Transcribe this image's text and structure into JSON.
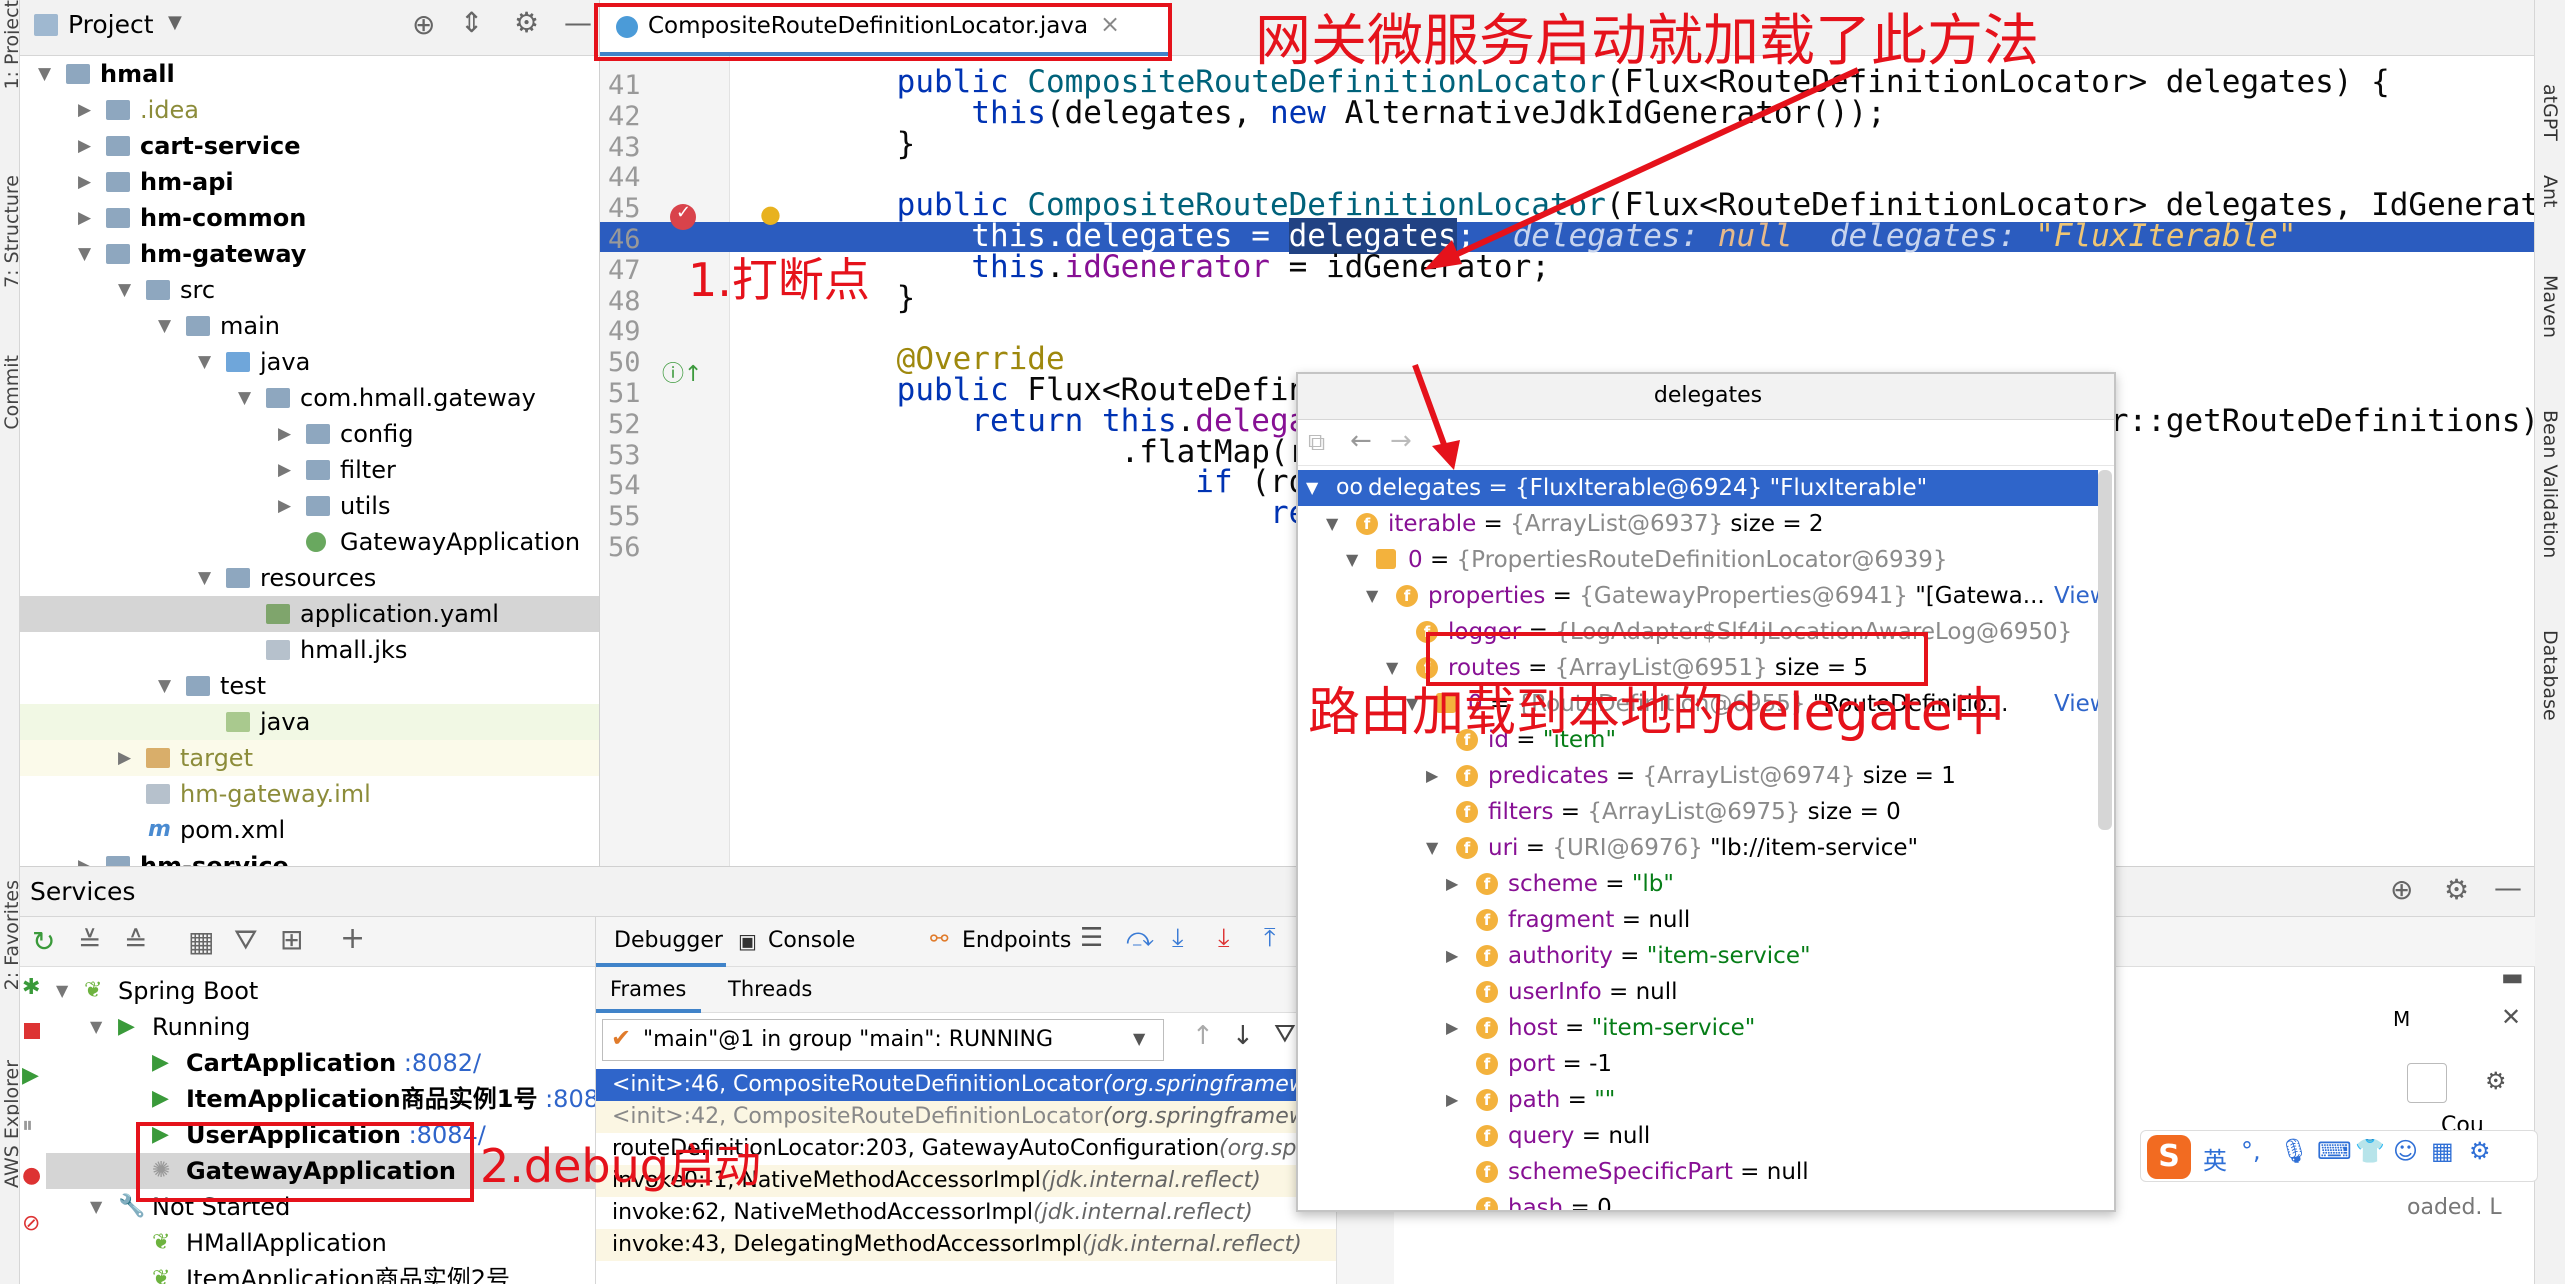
{
  "left_strip": {
    "tabs": [
      "1: Project",
      "7: Structure",
      "Commit",
      "2: Favorites",
      "AWS Explorer"
    ]
  },
  "right_strip": {
    "tabs": [
      "atGPT",
      "Ant",
      "Maven",
      "Bean Validation",
      "Database"
    ]
  },
  "project": {
    "title": "Project",
    "tree": [
      {
        "label": "hmall",
        "depth": 0,
        "arrow": "▼",
        "icon": "fold",
        "bold": true
      },
      {
        "label": ".idea",
        "depth": 1,
        "arrow": "▶",
        "icon": "fold",
        "color": "#8c8c3a"
      },
      {
        "label": "cart-service",
        "depth": 1,
        "arrow": "▶",
        "icon": "fold",
        "bold": true
      },
      {
        "label": "hm-api",
        "depth": 1,
        "arrow": "▶",
        "icon": "fold",
        "bold": true
      },
      {
        "label": "hm-common",
        "depth": 1,
        "arrow": "▶",
        "icon": "fold",
        "bold": true
      },
      {
        "label": "hm-gateway",
        "depth": 1,
        "arrow": "▼",
        "icon": "fold",
        "bold": true
      },
      {
        "label": "src",
        "depth": 2,
        "arrow": "▼",
        "icon": "fold"
      },
      {
        "label": "main",
        "depth": 3,
        "arrow": "▼",
        "icon": "fold"
      },
      {
        "label": "java",
        "depth": 4,
        "arrow": "▼",
        "icon": "foldb"
      },
      {
        "label": "com.hmall.gateway",
        "depth": 5,
        "arrow": "▼",
        "icon": "fold"
      },
      {
        "label": "config",
        "depth": 6,
        "arrow": "▶",
        "icon": "fold"
      },
      {
        "label": "filter",
        "depth": 6,
        "arrow": "▶",
        "icon": "fold"
      },
      {
        "label": "utils",
        "depth": 6,
        "arrow": "▶",
        "icon": "fold"
      },
      {
        "label": "GatewayApplication",
        "depth": 6,
        "arrow": "",
        "icon": "fileg"
      },
      {
        "label": "resources",
        "depth": 4,
        "arrow": "▼",
        "icon": "fold"
      },
      {
        "label": "application.yaml",
        "depth": 5,
        "arrow": "",
        "icon": "filey",
        "selected": true
      },
      {
        "label": "hmall.jks",
        "depth": 5,
        "arrow": "",
        "icon": "filej"
      },
      {
        "label": "test",
        "depth": 3,
        "arrow": "▼",
        "icon": "fold"
      },
      {
        "label": "java",
        "depth": 4,
        "arrow": "",
        "icon": "foldg",
        "highlight": true
      },
      {
        "label": "target",
        "depth": 2,
        "arrow": "▶",
        "icon": "foldo",
        "color": "#8c8c3a",
        "highlight2": true
      },
      {
        "label": "hm-gateway.iml",
        "depth": 2,
        "arrow": "",
        "icon": "filej",
        "color": "#8c8c3a"
      },
      {
        "label": "pom.xml",
        "depth": 2,
        "arrow": "",
        "icon": "m"
      },
      {
        "label": "hm-service",
        "depth": 1,
        "arrow": "▶",
        "icon": "fold",
        "bold": true
      }
    ]
  },
  "editor": {
    "tab": "CompositeRouteDefinitionLocator.java",
    "close": "×",
    "lines": [
      {
        "n": "41",
        "html": "    <span class=\"kw\">public</span> <span class=\"ty\">CompositeRouteDefinitionLocator</span>(Flux&lt;RouteDefinitionLocator&gt; delegates) {"
      },
      {
        "n": "42",
        "html": "        <span class=\"kw\">this</span>(delegates, <span class=\"kw\">new</span> AlternativeJdkIdGenerator());"
      },
      {
        "n": "43",
        "html": "    }"
      },
      {
        "n": "44",
        "html": ""
      },
      {
        "n": "45",
        "html": "    <span class=\"kw\">public</span> <span class=\"ty\">CompositeRouteDefinitionLocator</span>(Flux&lt;RouteDefinitionLocator&gt; delegates, IdGenerator idGenerator) {"
      },
      {
        "n": "46",
        "html": "        this.delegates = <span class=\"hl\">delegates</span>;  <i style=\"color:#c7d4ee\">delegates: </i><i style=\"color:#e6b98a\">null</i>  <i style=\"color:#c7d4ee\">delegates: </i><i style=\"color:#f0c674\">\"FluxIterable\"</i>"
      },
      {
        "n": "47",
        "html": "        <span class=\"kw\">this</span>.<span class=\"fi\">idGenerator</span> = idGenerator;"
      },
      {
        "n": "48",
        "html": "    }"
      },
      {
        "n": "49",
        "html": ""
      },
      {
        "n": "50",
        "html": "    <span class=\"an\">@Override</span>"
      },
      {
        "n": "51",
        "html": "    <span class=\"kw\">public</span> Flux&lt;RouteDefinition&gt; getRouteDefinitions() {"
      },
      {
        "n": "52",
        "html": "        <span class=\"kw\">return</span> <span class=\"kw\">this</span>.<span class=\"fi\">delegates</span>.flatMapSequential(RouteDefinitionLocator::getRouteDefinitions)"
      },
      {
        "n": "53",
        "html": "                .flatMap(routeDefinition -&gt; {"
      },
      {
        "n": "54",
        "html": "                    <span class=\"kw\">if</span> (routeDefinition.getId() == <span class=\"kw\">null</span>) {"
      },
      {
        "n": "55",
        "html": "                        <span class=\"kw\">return</span> randomId().map(id -&gt; {"
      },
      {
        "n": "56",
        "html": ""
      }
    ]
  },
  "popup": {
    "title": "delegates",
    "rows": [
      {
        "d": 0,
        "tri": "▼",
        "ico": "oo",
        "name": "delegates",
        "val": " = {FluxIterable@6924} \"FluxIterable\"",
        "sel": true
      },
      {
        "d": 1,
        "tri": "▼",
        "ico": "f",
        "name": "iterable",
        "eq": " = ",
        "gray": "{ArrayList@6937}",
        "rest": "  size = 2"
      },
      {
        "d": 2,
        "tri": "▼",
        "ico": "=",
        "name": "0",
        "eq": " = ",
        "gray": "{PropertiesRouteDefinitionLocator@6939}",
        "rest": ""
      },
      {
        "d": 3,
        "tri": "▼",
        "ico": "f",
        "name": "properties",
        "eq": " = ",
        "gray": "{GatewayProperties@6941}",
        "rest": " \"[Gatewa...",
        "link": "View"
      },
      {
        "d": 4,
        "tri": "",
        "ico": "f",
        "name": "logger",
        "eq": " = ",
        "gray": "{LogAdapter$Slf4jLocationAwareLog@6950}",
        "rest": ""
      },
      {
        "d": 4,
        "tri": "▼",
        "ico": "f",
        "name": "routes",
        "eq": " = ",
        "gray": "{ArrayList@6951}",
        "rest": "  size = 5"
      },
      {
        "d": 5,
        "tri": "▼",
        "ico": "=",
        "name": "0",
        "eq": " = ",
        "gray": "{RouteDefinition@6955}",
        "rest": " \"RouteDefinitio...",
        "link": "View"
      },
      {
        "d": 6,
        "tri": "",
        "ico": "f",
        "name": "id",
        "eq": " = ",
        "str": "\"item\""
      },
      {
        "d": 6,
        "tri": "▶",
        "ico": "f",
        "name": "predicates",
        "eq": " = ",
        "gray": "{ArrayList@6974}",
        "rest": "  size = 1"
      },
      {
        "d": 6,
        "tri": "",
        "ico": "f",
        "name": "filters",
        "eq": " = ",
        "gray": "{ArrayList@6975}",
        "rest": "  size = 0"
      },
      {
        "d": 6,
        "tri": "▼",
        "ico": "f",
        "name": "uri",
        "eq": " = ",
        "gray": "{URI@6976}",
        "rest": " \"lb://item-service\""
      },
      {
        "d": 7,
        "tri": "▶",
        "ico": "f",
        "name": "scheme",
        "eq": " = ",
        "str": "\"lb\""
      },
      {
        "d": 7,
        "tri": "",
        "ico": "f",
        "name": "fragment",
        "eq": " = ",
        "rest": "null"
      },
      {
        "d": 7,
        "tri": "▶",
        "ico": "f",
        "name": "authority",
        "eq": " = ",
        "str": "\"item-service\""
      },
      {
        "d": 7,
        "tri": "",
        "ico": "f",
        "name": "userInfo",
        "eq": " = ",
        "rest": "null"
      },
      {
        "d": 7,
        "tri": "▶",
        "ico": "f",
        "name": "host",
        "eq": " = ",
        "str": "\"item-service\""
      },
      {
        "d": 7,
        "tri": "",
        "ico": "f",
        "name": "port",
        "eq": " = ",
        "rest": "-1"
      },
      {
        "d": 7,
        "tri": "▶",
        "ico": "f",
        "name": "path",
        "eq": " = ",
        "str": "\"\""
      },
      {
        "d": 7,
        "tri": "",
        "ico": "f",
        "name": "query",
        "eq": " = ",
        "rest": "null"
      },
      {
        "d": 7,
        "tri": "",
        "ico": "f",
        "name": "schemeSpecificPart",
        "eq": " = ",
        "rest": "null"
      },
      {
        "d": 7,
        "tri": "",
        "ico": "f",
        "name": "hash",
        "eq": " = ",
        "rest": "0"
      }
    ]
  },
  "services": {
    "title": "Services",
    "tree": [
      {
        "label": "Spring Boot",
        "d": 0,
        "tri": "▼",
        "ico": "leaf"
      },
      {
        "label": "Running",
        "d": 1,
        "tri": "▼",
        "ico": "run"
      },
      {
        "label": "CartApplication",
        "port": " :8082/",
        "d": 2,
        "ico": "run",
        "bold": true
      },
      {
        "label": "ItemApplication商品实例1号",
        "port": " :8081/",
        "d": 2,
        "ico": "run",
        "bold": true
      },
      {
        "label": "UserApplication",
        "port": " :8084/",
        "d": 2,
        "ico": "run",
        "bold": true
      },
      {
        "label": "GatewayApplication",
        "port": "",
        "d": 2,
        "ico": "spin",
        "bold": true,
        "selected": true
      },
      {
        "label": "Not Started",
        "d": 1,
        "tri": "▼",
        "ico": "wrench"
      },
      {
        "label": "HMallApplication",
        "d": 2,
        "ico": "leaf"
      },
      {
        "label": "ItemApplication商品实例2号",
        "d": 2,
        "ico": "leaf"
      }
    ]
  },
  "debugger": {
    "tabs": [
      "Debugger",
      "Console",
      "Endpoints"
    ],
    "subtabs": [
      "Frames",
      "Threads"
    ],
    "thread": "\"main\"@1 in group \"main\": RUNNING",
    "frames": [
      {
        "t": "<init>:46, CompositeRouteDefinitionLocator",
        "p": " (org.springframework.cloud.gateway.route)",
        "sel": true
      },
      {
        "t": "<init>:42, CompositeRouteDefinitionLocator",
        "p": " (org.springframework.cloud.gateway.route)",
        "dim": true
      },
      {
        "t": "routeDefinitionLocator:203, GatewayAutoConfiguration",
        "p": " (org.springframework.cloud.gateway.config)"
      },
      {
        "t": "invoke0:-1, NativeMethodAccessorImpl",
        "p": " (jdk.internal.reflect)"
      },
      {
        "t": "invoke:62, NativeMethodAccessorImpl",
        "p": " (jdk.internal.reflect)"
      },
      {
        "t": "invoke:43, DelegatingMethodAccessorImpl",
        "p": " (jdk.internal.reflect)"
      }
    ],
    "right_m": "M",
    "right_cou": "Cou",
    "right_loaded": "oaded. L"
  },
  "ime": {
    "text": "英",
    "glyph": "S"
  },
  "annotations": {
    "title": "网关微服务启动就加载了此方法",
    "step1": "1.打断点",
    "step2": "2.debug启动",
    "routes_note": "路由加载到本地的delegate中"
  }
}
